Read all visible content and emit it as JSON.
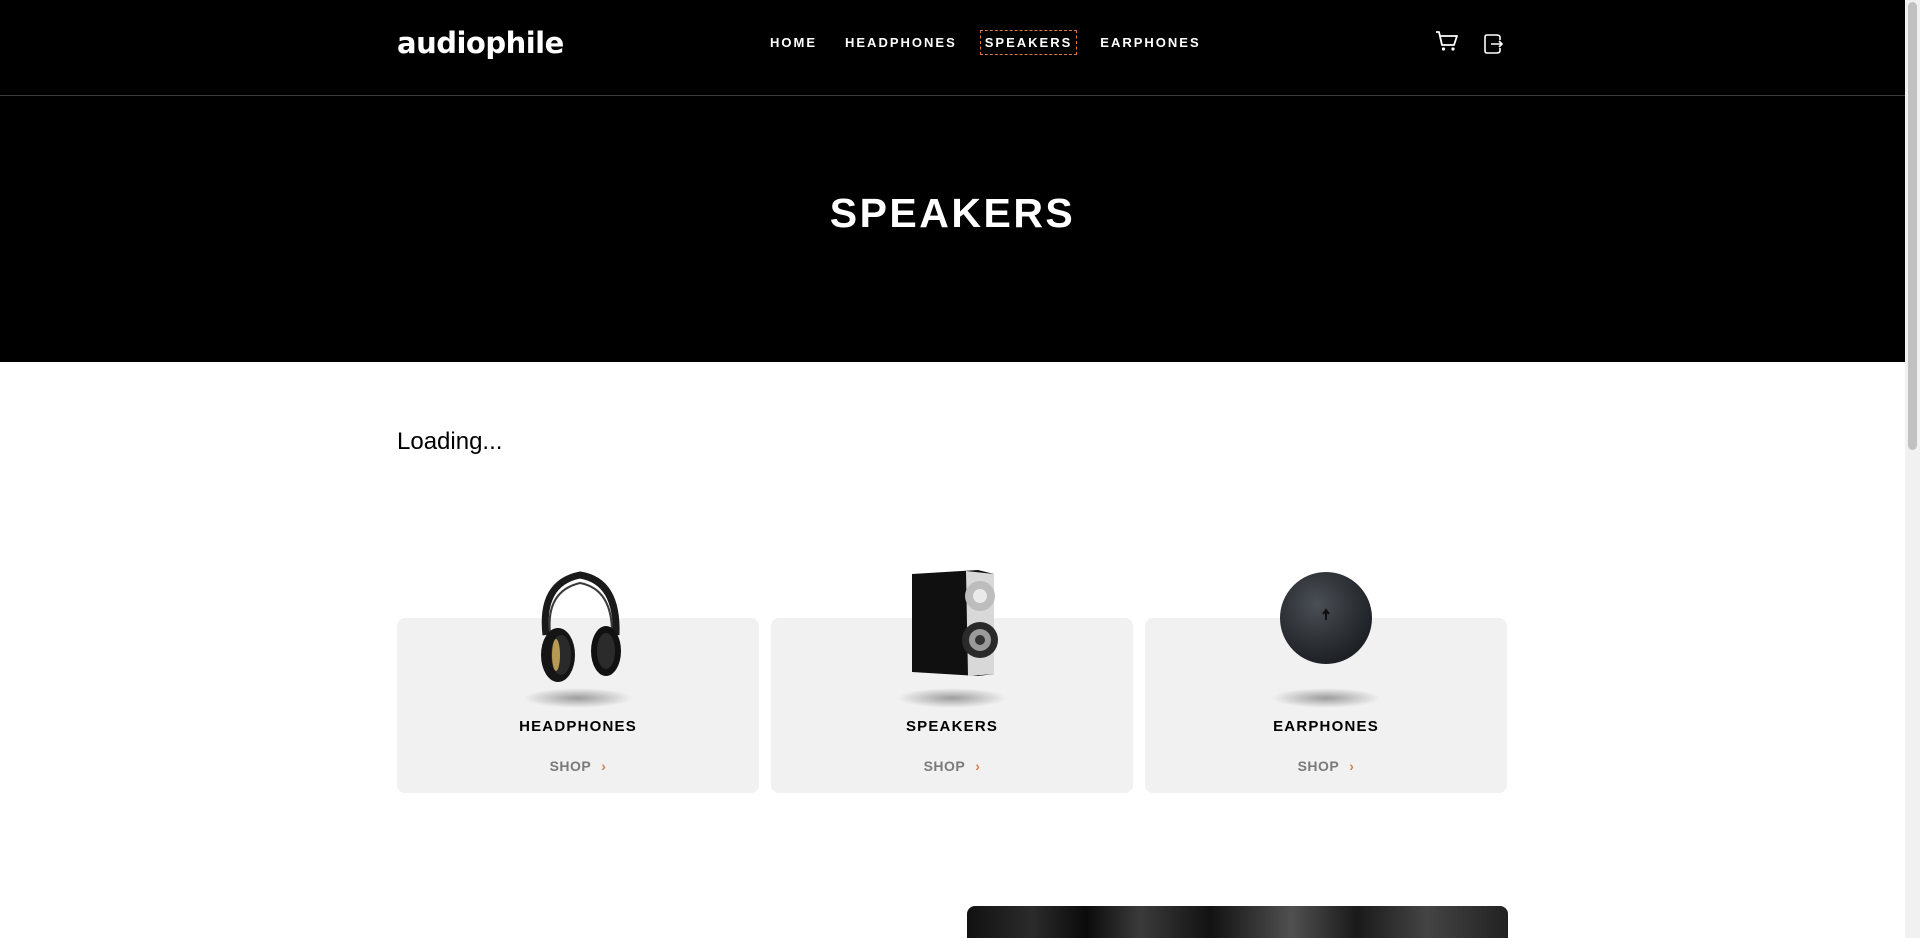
{
  "header": {
    "logo": "audiophile",
    "nav": [
      {
        "label": "HOME"
      },
      {
        "label": "HEADPHONES"
      },
      {
        "label": "SPEAKERS",
        "active": true
      },
      {
        "label": "EARPHONES"
      }
    ],
    "icons": [
      "cart-icon",
      "logout-icon"
    ]
  },
  "hero": {
    "title": "SPEAKERS"
  },
  "main": {
    "loading_text": "Loading..."
  },
  "categories": [
    {
      "label": "HEADPHONES",
      "shop": "SHOP",
      "icon": "headphones-image"
    },
    {
      "label": "SPEAKERS",
      "shop": "SHOP",
      "icon": "speaker-image"
    },
    {
      "label": "EARPHONES",
      "shop": "SHOP",
      "icon": "earphones-case-image"
    }
  ],
  "colors": {
    "accent": "#D87D4A",
    "card_bg": "#F1F1F1",
    "dark": "#000000"
  }
}
